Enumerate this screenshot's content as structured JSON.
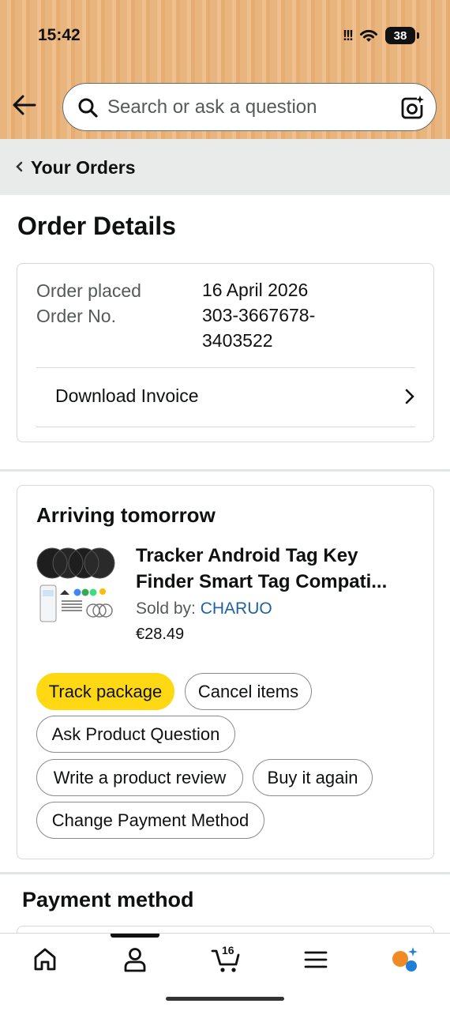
{
  "status_bar": {
    "time": "15:42",
    "signal": "!!!",
    "battery": "38"
  },
  "header": {
    "search": {
      "placeholder": "Search or ask a question"
    }
  },
  "breadcrumb": {
    "label": "Your Orders"
  },
  "page_title": "Order Details",
  "order_info": {
    "placed_label": "Order placed",
    "placed_value": "16 April 2026",
    "number_label": "Order No.",
    "number_value_line1": "303-3667678-",
    "number_value_line2": "3403522",
    "invoice_label": "Download Invoice"
  },
  "shipment": {
    "status": "Arriving tomorrow",
    "product": {
      "title_line1": "Tracker Android Tag Key",
      "title_line2": "Finder Smart Tag Compati...",
      "sold_by_prefix": "Sold by: ",
      "seller": "CHARUO",
      "price": "€28.49"
    },
    "actions": {
      "track": "Track package",
      "cancel": "Cancel items",
      "ask": "Ask Product Question",
      "review": "Write a product review",
      "buy_again": "Buy it again",
      "change_payment": "Change Payment Method"
    }
  },
  "payment_section": {
    "title": "Payment method"
  },
  "bottom_nav": {
    "cart_count": "16"
  },
  "icons": {
    "back": "back-arrow-icon",
    "search": "search-icon",
    "camera": "camera-lens-icon",
    "home": "home-icon",
    "account": "account-icon",
    "cart": "cart-icon",
    "menu": "menu-icon",
    "assistant": "assistant-icon"
  },
  "colors": {
    "header_bg": "#e9b57e",
    "primary_button": "#ffd814",
    "link": "#2162a1",
    "crumb_bg": "#e9ebeb"
  }
}
